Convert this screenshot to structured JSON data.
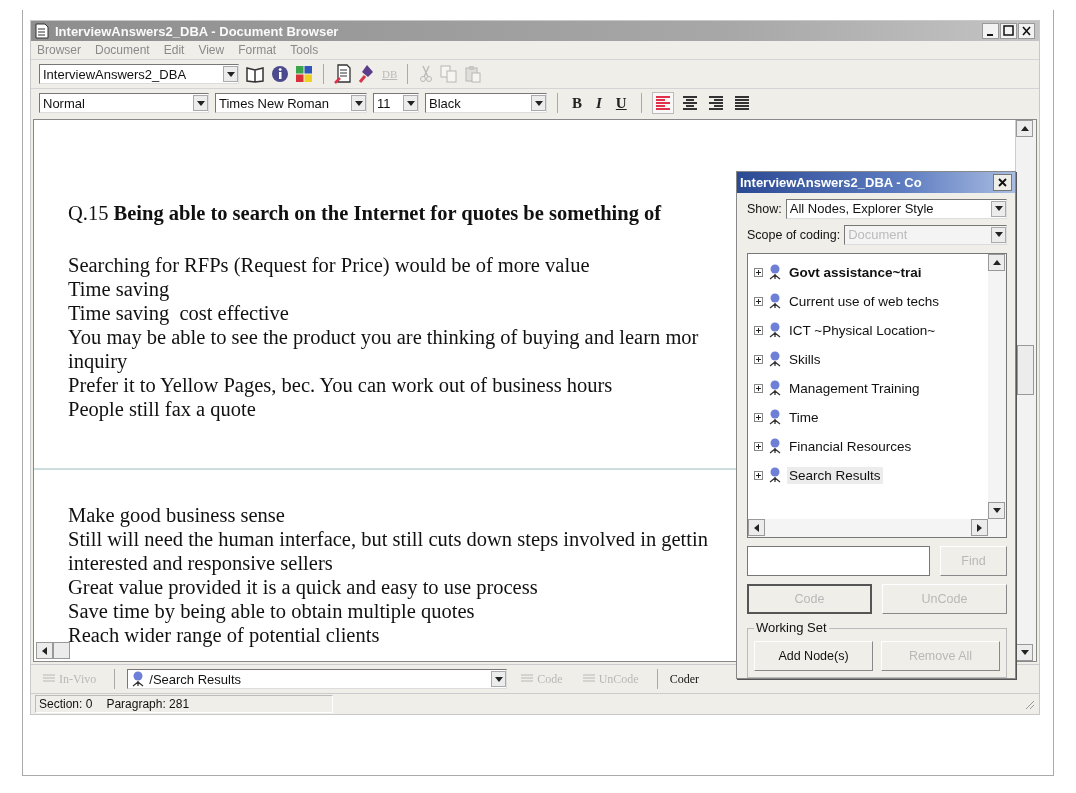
{
  "window": {
    "title": "InterviewAnswers2_DBA - Document Browser",
    "active": false
  },
  "menu": [
    {
      "label": "Browser",
      "disabled": true
    },
    {
      "label": "Document",
      "disabled": true
    },
    {
      "label": "Edit",
      "disabled": true
    },
    {
      "label": "View",
      "disabled": true
    },
    {
      "label": "Format",
      "disabled": true
    },
    {
      "label": "Tools",
      "disabled": true
    }
  ],
  "toolbar": {
    "document": "InterviewAnswers2_DBA",
    "buttons": [
      {
        "kind": "book",
        "disabled": false
      },
      {
        "kind": "info",
        "disabled": false
      },
      {
        "kind": "palette",
        "disabled": false
      },
      {
        "kind": "sep"
      },
      {
        "kind": "document",
        "disabled": false
      },
      {
        "kind": "pin",
        "disabled": false
      },
      {
        "kind": "db",
        "label": "DB",
        "disabled": true
      },
      {
        "kind": "sep"
      },
      {
        "kind": "cut",
        "disabled": true
      },
      {
        "kind": "copy",
        "disabled": true
      },
      {
        "kind": "paste",
        "disabled": true
      }
    ]
  },
  "format_bar": {
    "style": "Normal",
    "font": "Times New Roman",
    "size": "11",
    "font_color_name": "Black",
    "buttons": [
      {
        "kind": "bold",
        "label": "B"
      },
      {
        "kind": "italic",
        "label": "I"
      },
      {
        "kind": "underline",
        "label": "U"
      }
    ],
    "alignment": [
      {
        "kind": "left",
        "selected": true
      },
      {
        "kind": "center",
        "selected": false
      },
      {
        "kind": "right",
        "selected": false
      },
      {
        "kind": "justify",
        "selected": false
      }
    ]
  },
  "document": {
    "sections": [
      {
        "heading": "Q.15 **Being able to search on the Internet for quotes be something of**",
        "lines": [
          "Searching for RFPs (Request for Price) would be of more value",
          "Time saving",
          "Time saving  cost effective",
          "You may be able to see the product you are thinking of buying and learn mor",
          "inquiry",
          "Prefer it to Yellow Pages, bec. You can work out of business hours",
          "People still fax a quote"
        ]
      },
      {
        "lines": [
          "Make good business sense",
          "Still will need the human interface, but still cuts down steps involved in gettin",
          "interested and responsive sellers",
          "Great value provided it is a quick and easy to use process",
          "Save time by being able to obtain multiple quotes",
          "Reach wider range of potential clients"
        ]
      }
    ]
  },
  "coder_panel": {
    "title": "InterviewAnswers2_DBA - Co",
    "show_label": "Show:",
    "show_value": "All Nodes, Explorer Style",
    "scope_label": "Scope of coding:",
    "scope_value": "Document",
    "scope_disabled": true,
    "nodes": [
      {
        "label": "Govt assistance~trai",
        "emphasized": true,
        "selected": false
      },
      {
        "label": "Current use of web techs",
        "emphasized": false,
        "selected": false
      },
      {
        "label": "ICT ~Physical Location~",
        "emphasized": false,
        "selected": false
      },
      {
        "label": "Skills",
        "emphasized": false,
        "selected": false
      },
      {
        "label": "Management Training",
        "emphasized": false,
        "selected": false
      },
      {
        "label": "Time",
        "emphasized": false,
        "selected": false
      },
      {
        "label": "Financial Resources",
        "emphasized": false,
        "selected": false
      },
      {
        "label": "Search Results",
        "emphasized": false,
        "selected": true
      }
    ],
    "find": {
      "label": "Find",
      "disabled": true
    },
    "code": {
      "label": "Code",
      "disabled": true
    },
    "uncode": {
      "label": "UnCode",
      "disabled": true
    },
    "working_set": {
      "title": "Working Set",
      "add": {
        "label": "Add Node(s)",
        "disabled": false
      },
      "remove": {
        "label": "Remove All",
        "disabled": true
      }
    }
  },
  "coding_bar": {
    "invivo": {
      "label": "In-Vivo",
      "disabled": true
    },
    "node": "/Search Results",
    "code": {
      "label": "Code",
      "disabled": true
    },
    "uncode": {
      "label": "UnCode",
      "disabled": true
    },
    "coder": "Coder"
  },
  "status_bar": {
    "section": "Section: 0",
    "paragraph": "Paragraph: 281"
  }
}
